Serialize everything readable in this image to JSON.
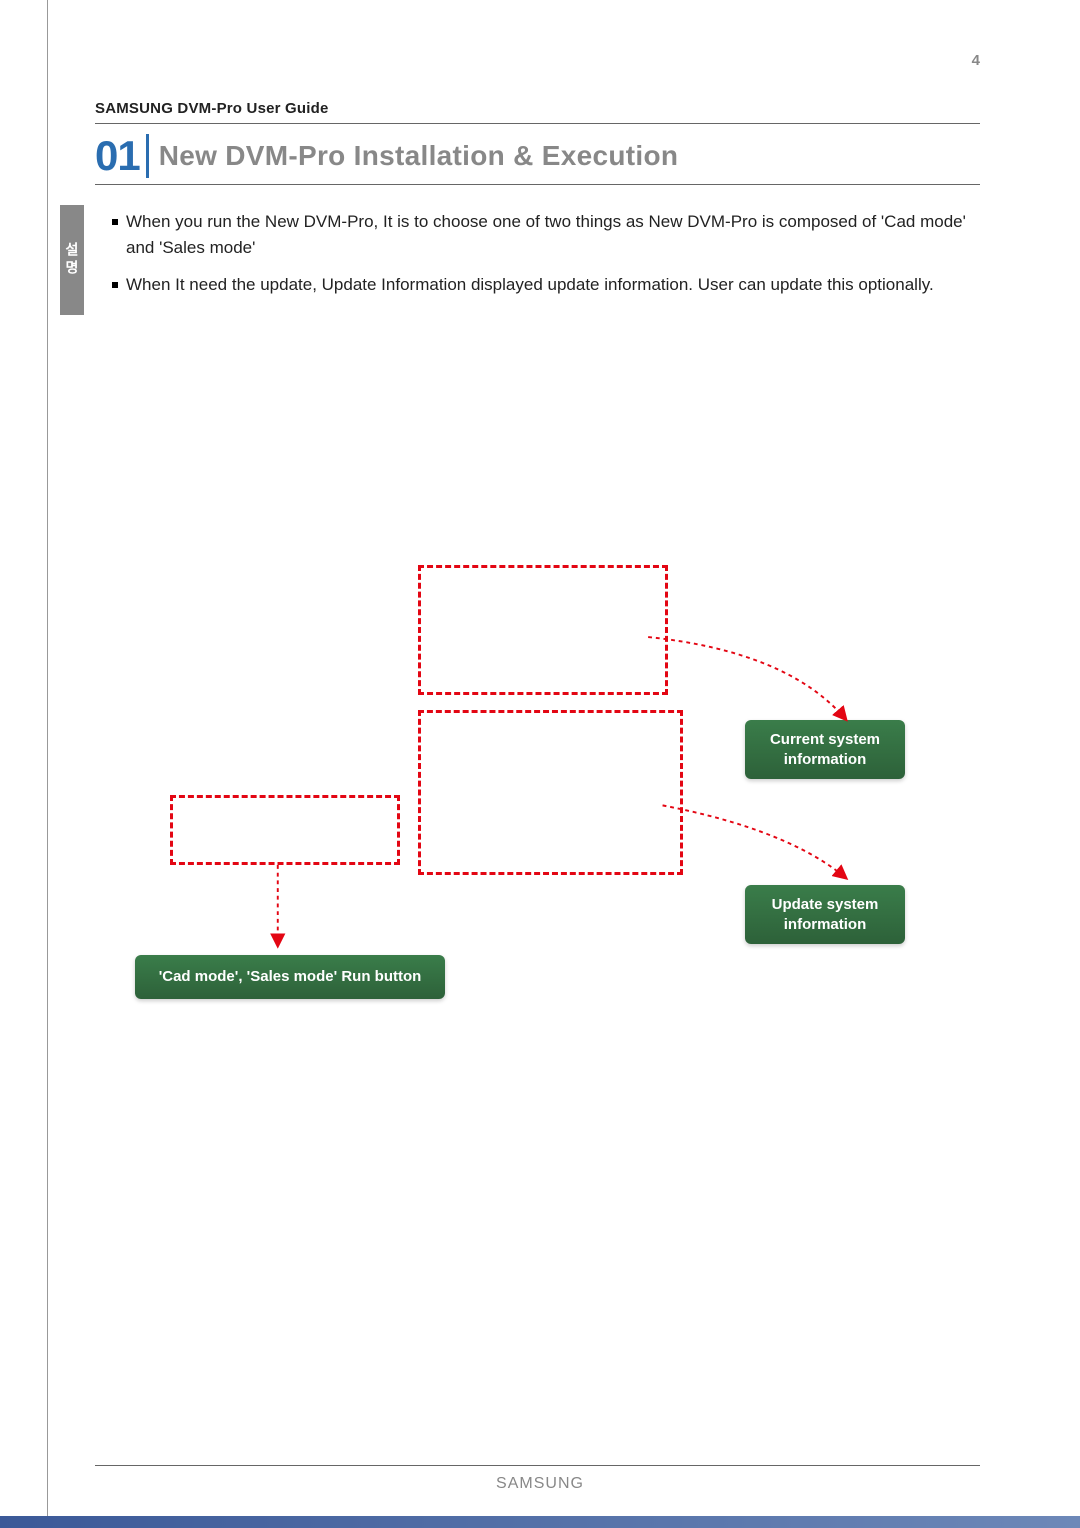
{
  "page_number": "4",
  "doc_header": "SAMSUNG DVM-Pro User Guide",
  "section_number": "01",
  "section_title": "New DVM-Pro Installation & Execution",
  "vertical_tag": "설명",
  "bullets": [
    "When you run the New DVM-Pro, It is to choose one of two things as New DVM-Pro is composed of 'Cad mode' and 'Sales mode'",
    "When It need the update, Update Information displayed update information. User can update this optionally."
  ],
  "callouts": {
    "current": "Current system information",
    "update": "Update system information",
    "runbtn": "'Cad mode', 'Sales mode' Run button"
  },
  "footer_brand": "SAMSUNG"
}
